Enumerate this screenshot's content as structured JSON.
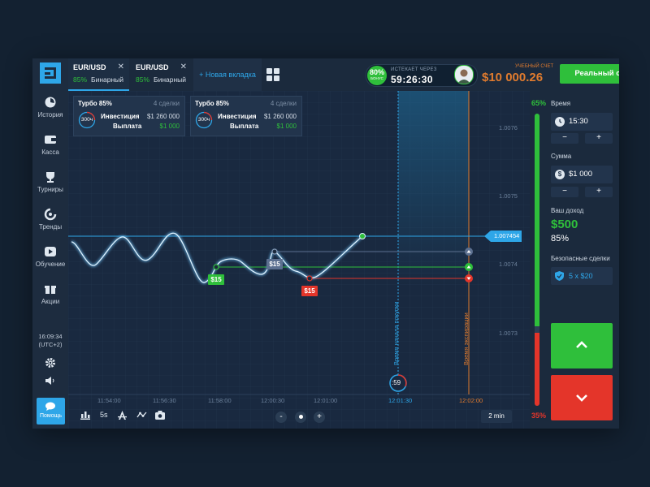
{
  "sidebar": {
    "items": [
      {
        "label": "История",
        "icon": "history-icon"
      },
      {
        "label": "Касса",
        "icon": "wallet-icon"
      },
      {
        "label": "Турниры",
        "icon": "trophy-icon"
      },
      {
        "label": "Тренды",
        "icon": "trends-icon"
      },
      {
        "label": "Обучение",
        "icon": "play-icon"
      },
      {
        "label": "Акции",
        "icon": "gift-icon"
      }
    ],
    "time": "16:09:34",
    "timezone": "(UTC+2)",
    "help_label": "Помощь"
  },
  "tabs": [
    {
      "pair": "EUR/USD",
      "percent": "85%",
      "mode": "Бинарный"
    },
    {
      "pair": "EUR/USD",
      "percent": "85%",
      "mode": "Бинарный"
    }
  ],
  "new_tab_label": "+ Новая вкладка",
  "timer": {
    "bonus_value": "80%",
    "bonus_label": "БОНУС",
    "label": "ИСТЕКАЕТ ЧЕРЕЗ",
    "value": "59:26:30"
  },
  "account": {
    "label": "УЧЕБНЫЙ СЧЕТ",
    "balance": "$10 000.26",
    "real_button": "Реальный счет"
  },
  "cards": [
    {
      "title": "Турбо 85%",
      "deals": "4 сделки",
      "ring": "300ч",
      "invest_label": "Инвестиция",
      "invest_value": "$1 260 000",
      "payout_label": "Выплата",
      "payout_value": "$1 000"
    },
    {
      "title": "Турбо 85%",
      "deals": "4 сделки",
      "ring": "300ч",
      "invest_label": "Инвестиция",
      "invest_value": "$1 260 000",
      "payout_label": "Выплата",
      "payout_value": "$1 000"
    }
  ],
  "chart": {
    "y_ticks": [
      "1.0076",
      "1.0075",
      "1.0074",
      "1.0073"
    ],
    "x_ticks": [
      "11:54:00",
      "11:56:30",
      "11:58:00",
      "12:00:30",
      "12:01:00"
    ],
    "current_price": "1.007454",
    "purchase_time": "12:01:30",
    "purchase_label": "Время начала покупки",
    "expiry_time": "12:02:00",
    "expiry_label": "Время экспирации",
    "countdown": ":59",
    "deals": [
      {
        "amount": "$15",
        "direction": "up"
      },
      {
        "amount": "$15",
        "direction": "neutral"
      },
      {
        "amount": "$15",
        "direction": "down"
      }
    ],
    "toolbar": {
      "interval": "5s",
      "timeframe": "2 min",
      "zoom_out": "-",
      "zoom_in": "+"
    }
  },
  "panel": {
    "up_percent": "65%",
    "down_percent": "35%",
    "time_label": "Время",
    "time_value": "15:30",
    "amount_label": "Сумма",
    "amount_value": "$1 000",
    "minus": "−",
    "plus": "+",
    "income_label": "Ваш доход",
    "income_value": "$500",
    "income_percent": "85%",
    "safe_label": "Безопасные сделки",
    "safe_value": "5 x $20"
  },
  "colors": {
    "accent": "#2ea6e8",
    "up": "#2fbf3b",
    "down": "#e4352a",
    "demo": "#e07b2e"
  }
}
